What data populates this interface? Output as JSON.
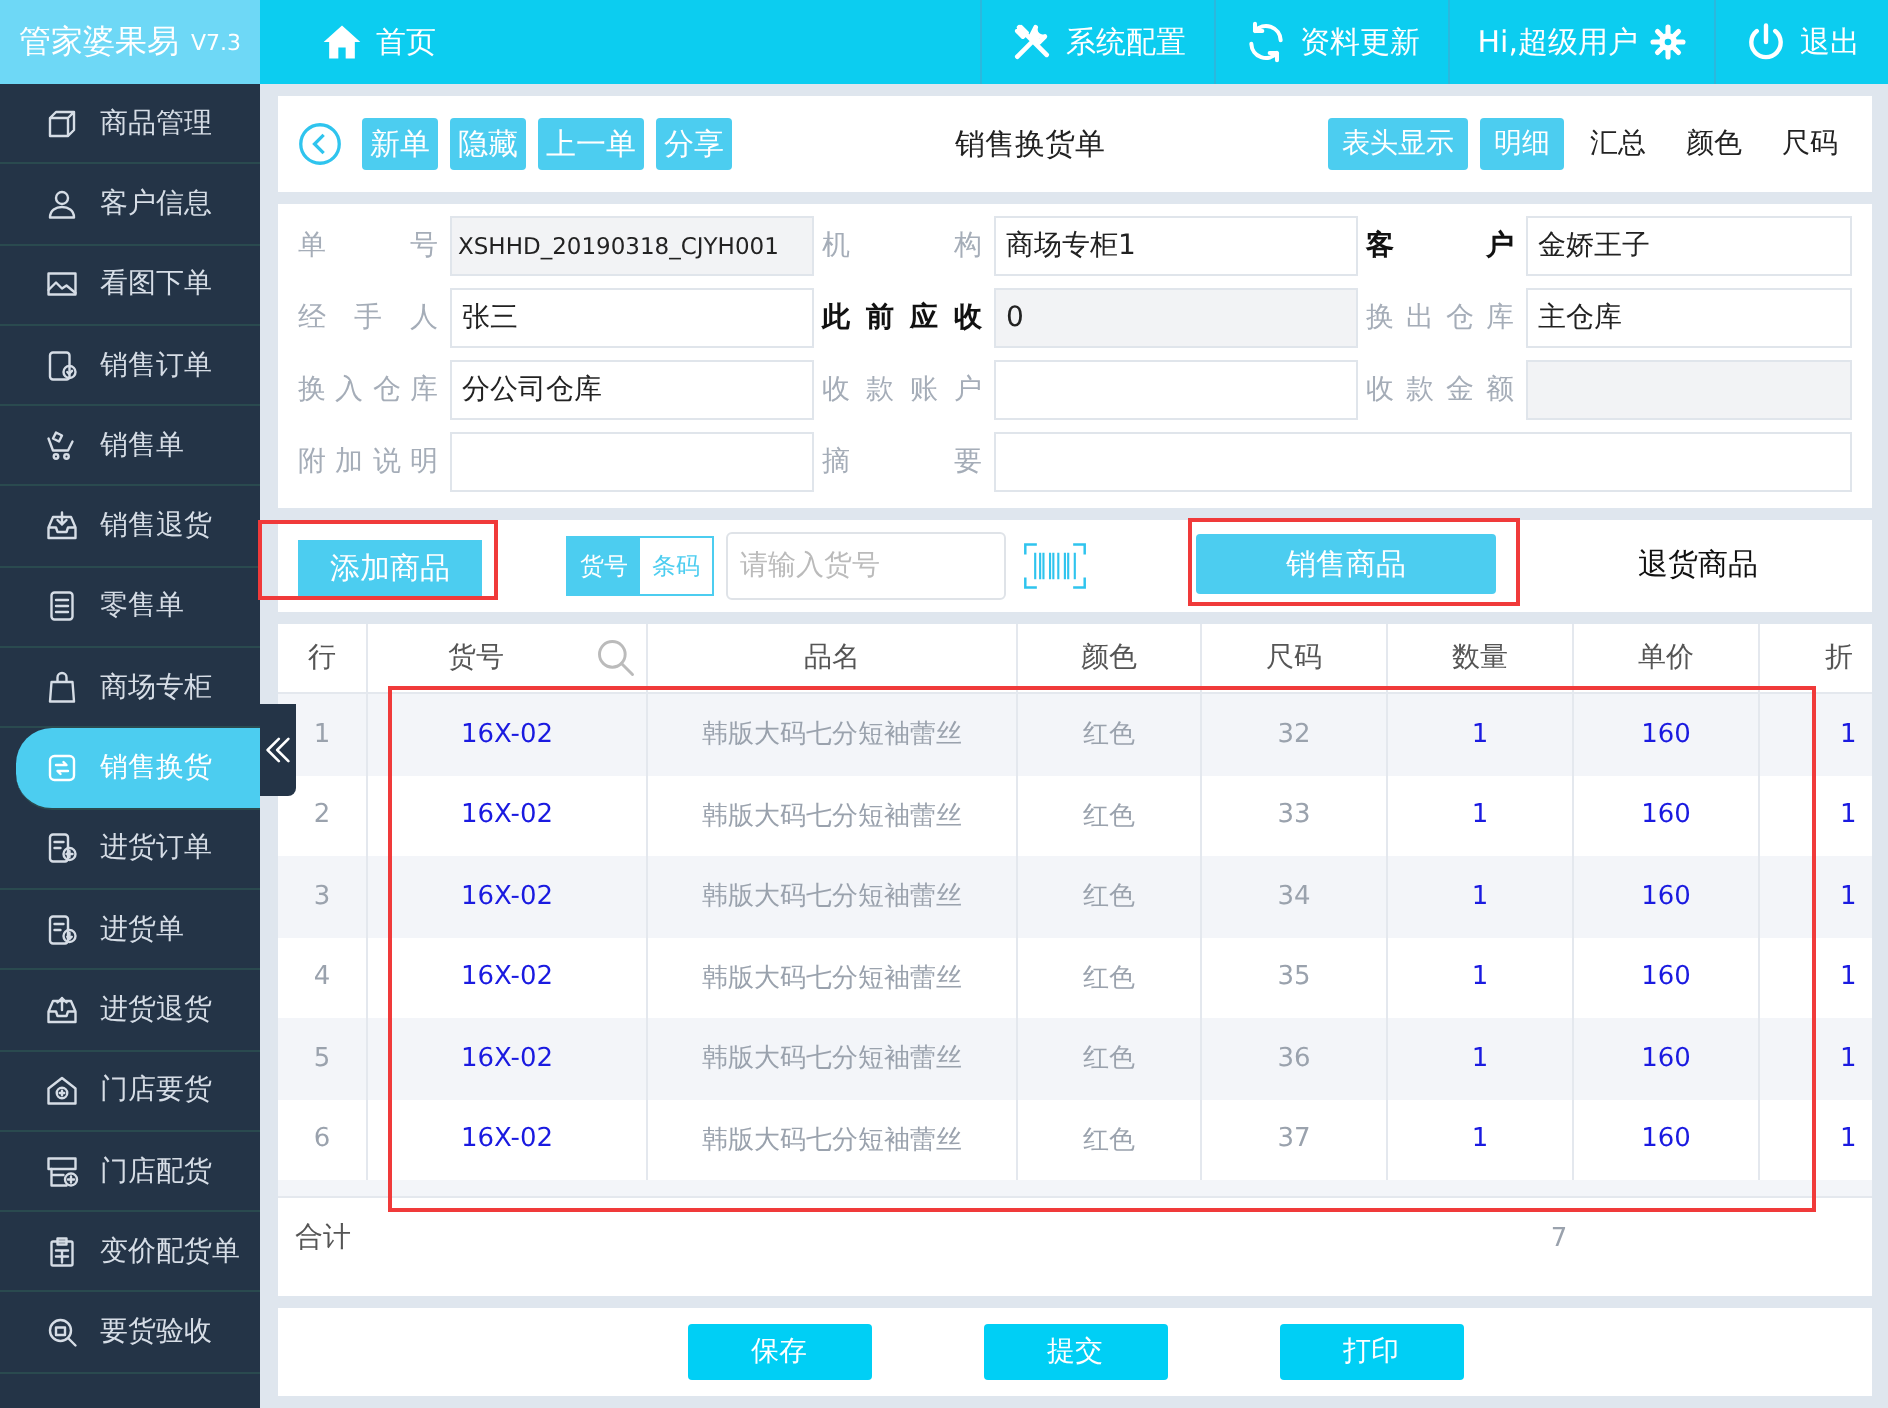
{
  "app": {
    "name": "管家婆果易",
    "version": "V7.3"
  },
  "top_nav": [
    {
      "kind": "home",
      "label": "首页"
    },
    {
      "kind": "tools",
      "label": "系统配置"
    },
    {
      "kind": "refresh",
      "label": "资料更新"
    },
    {
      "kind": "user",
      "label": "Hi,超级用户"
    },
    {
      "kind": "power",
      "label": "退出"
    }
  ],
  "sidebar": {
    "items": [
      {
        "kind": "box",
        "label": "商品管理",
        "selected": false
      },
      {
        "kind": "person",
        "label": "客户信息",
        "selected": false
      },
      {
        "kind": "image",
        "label": "看图下单",
        "selected": false
      },
      {
        "kind": "doccheck",
        "label": "销售订单",
        "selected": false
      },
      {
        "kind": "cart",
        "label": "销售单",
        "selected": false
      },
      {
        "kind": "tray",
        "label": "销售退货",
        "selected": false
      },
      {
        "kind": "doc",
        "label": "零售单",
        "selected": false
      },
      {
        "kind": "bag",
        "label": "商场专柜",
        "selected": false
      },
      {
        "kind": "exchange",
        "label": "销售换货",
        "selected": true
      },
      {
        "kind": "docplus",
        "label": "进货订单",
        "selected": false
      },
      {
        "kind": "docdown",
        "label": "进货单",
        "selected": false
      },
      {
        "kind": "trayup",
        "label": "进货退货",
        "selected": false
      },
      {
        "kind": "house",
        "label": "门店要货",
        "selected": false
      },
      {
        "kind": "shop",
        "label": "门店配货",
        "selected": false
      },
      {
        "kind": "clip",
        "label": "变价配货单",
        "selected": false
      },
      {
        "kind": "magnify",
        "label": "要货验收",
        "selected": false
      }
    ]
  },
  "toolbar": {
    "buttons": [
      "新单",
      "隐藏",
      "上一单",
      "分享"
    ],
    "title": "销售换货单",
    "views": [
      {
        "label": "表头显示",
        "selected": true
      },
      {
        "label": "明细",
        "selected": true
      },
      {
        "label": "汇总",
        "selected": false
      },
      {
        "label": "颜色",
        "selected": false
      },
      {
        "label": "尺码",
        "selected": false
      }
    ]
  },
  "form": [
    {
      "label": "单号",
      "value": "XSHHD_20190318_CJYH001",
      "bold": false,
      "readonly": true
    },
    {
      "label": "机构",
      "value": "商场专柜1",
      "bold": false,
      "readonly": false
    },
    {
      "label": "客户",
      "value": "金娇王子",
      "bold": true,
      "readonly": false
    },
    {
      "label": "经手人",
      "value": "张三",
      "bold": false,
      "readonly": false
    },
    {
      "label": "此前应收",
      "value": "0",
      "bold": true,
      "readonly": true
    },
    {
      "label": "换出仓库",
      "value": "主仓库",
      "bold": false,
      "readonly": false
    },
    {
      "label": "换入仓库",
      "value": "分公司仓库",
      "bold": false,
      "readonly": false
    },
    {
      "label": "收款账户",
      "bold": false,
      "readonly": false
    },
    {
      "label": "收款金额",
      "bold": false,
      "readonly": true
    },
    {
      "label": "附加说明",
      "bold": false,
      "readonly": false,
      "wide": false
    },
    {
      "label": "摘要",
      "bold": false,
      "readonly": false,
      "wide": true
    }
  ],
  "entry_bar": {
    "add_button": {
      "label": "添加商品",
      "highlighted": true
    },
    "modes": [
      {
        "label": "货号",
        "selected": true
      },
      {
        "label": "条码",
        "selected": false
      }
    ],
    "search": {
      "placeholder": "请输入货号"
    },
    "tabs": [
      {
        "label": "销售商品",
        "selected": true,
        "highlighted": true
      },
      {
        "label": "退货商品",
        "selected": false,
        "highlighted": false
      }
    ]
  },
  "table": {
    "columns": [
      "行",
      "货号",
      "品名",
      "颜色",
      "尺码",
      "数量",
      "单价",
      "折"
    ],
    "rows_highlighted": true,
    "rows": [
      [
        "1",
        "16X-02",
        "韩版大码七分短袖蕾丝",
        "红色",
        "32",
        "1",
        "160",
        "1"
      ],
      [
        "2",
        "16X-02",
        "韩版大码七分短袖蕾丝",
        "红色",
        "33",
        "1",
        "160",
        "1"
      ],
      [
        "3",
        "16X-02",
        "韩版大码七分短袖蕾丝",
        "红色",
        "34",
        "1",
        "160",
        "1"
      ],
      [
        "4",
        "16X-02",
        "韩版大码七分短袖蕾丝",
        "红色",
        "35",
        "1",
        "160",
        "1"
      ],
      [
        "5",
        "16X-02",
        "韩版大码七分短袖蕾丝",
        "红色",
        "36",
        "1",
        "160",
        "1"
      ],
      [
        "6",
        "16X-02",
        "韩版大码七分短袖蕾丝",
        "红色",
        "37",
        "1",
        "160",
        "1"
      ]
    ],
    "total": {
      "label": "合计",
      "quantity": "7"
    }
  },
  "footer_buttons": [
    "保存",
    "提交",
    "打印"
  ]
}
